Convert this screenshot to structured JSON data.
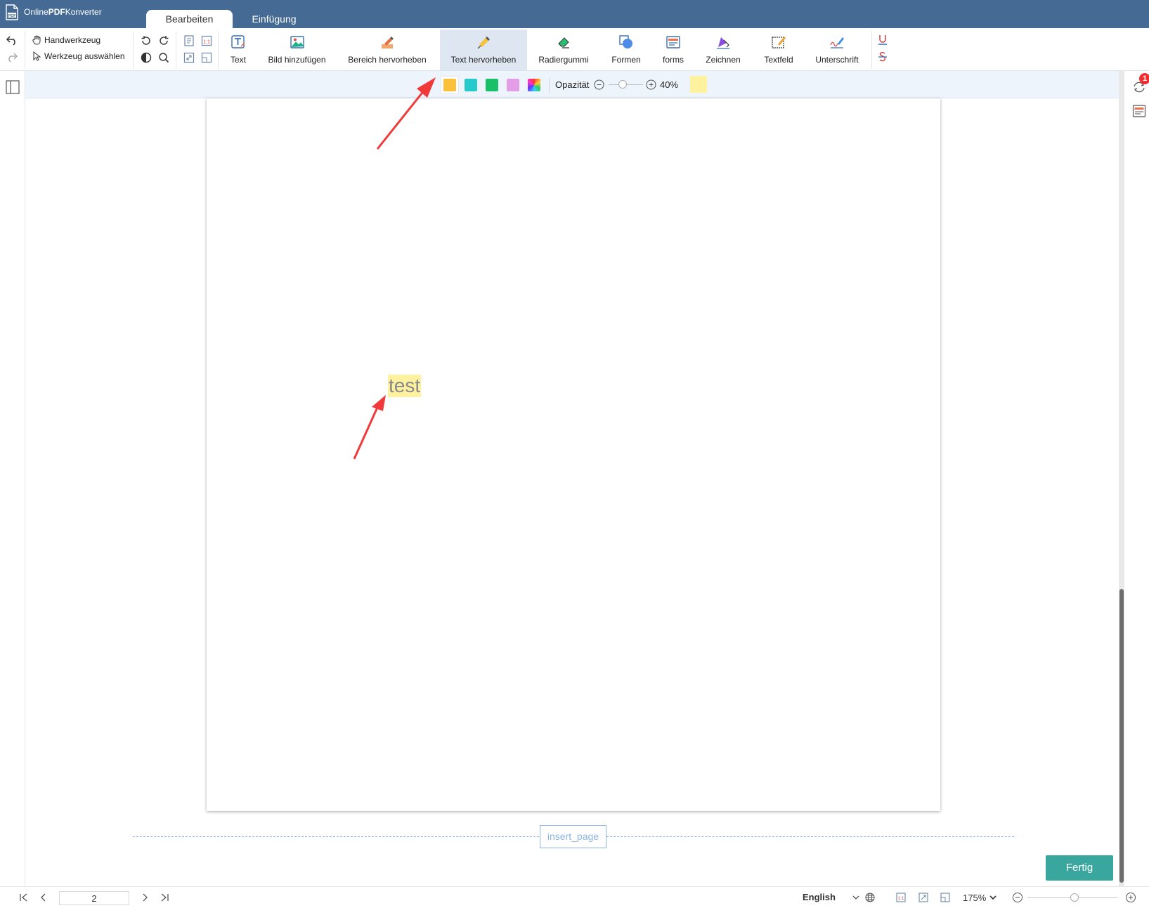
{
  "app": {
    "name_prefix": "Online",
    "name_bold": "PDF",
    "name_suffix": "Konverter",
    "logo_text": "PDF"
  },
  "tabs": [
    {
      "label": "Bearbeiten",
      "active": true
    },
    {
      "label": "Einfügung",
      "active": false
    }
  ],
  "toolbar": {
    "hand_tool": "Handwerkzeug",
    "select_tool": "Werkzeug auswählen",
    "actual_size_label": "1:1",
    "tools": [
      {
        "label": "Text"
      },
      {
        "label": "Bild hinzufügen"
      },
      {
        "label": "Bereich hervorheben"
      },
      {
        "label": "Text hervorheben",
        "active": true
      },
      {
        "label": "Radiergummi"
      },
      {
        "label": "Formen"
      },
      {
        "label": "forms"
      },
      {
        "label": "Zeichnen"
      },
      {
        "label": "Textfeld"
      },
      {
        "label": "Unterschrift"
      }
    ]
  },
  "highlight_options": {
    "colors": [
      "#fbbf3a",
      "#27c9cd",
      "#19c067",
      "#e39ee7"
    ],
    "current_color": "#fff29e",
    "opacity_label": "Opazität",
    "opacity_value": "40%",
    "opacity_level": 0.4
  },
  "document": {
    "highlighted_text": "test"
  },
  "insert_page_label": "insert_page",
  "done_button": "Fertig",
  "notification_badge": "1",
  "bottom": {
    "page_number": "2",
    "language": "English",
    "zoom": "175%",
    "actual_size_label": "1:1"
  },
  "colors": {
    "title_bar": "#456b94",
    "accent_done": "#3aa79f",
    "annotation_arrow": "#f03a3a",
    "highlight": "#fff29e"
  }
}
